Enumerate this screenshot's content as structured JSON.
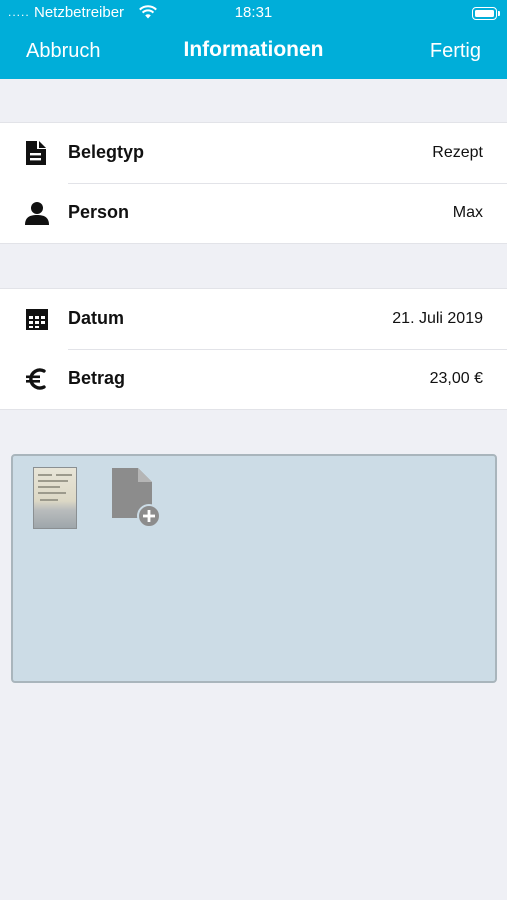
{
  "status_bar": {
    "signal": ".....",
    "carrier": "Netzbetreiber",
    "time": "18:31"
  },
  "nav": {
    "cancel_label": "Abbruch",
    "title": "Informationen",
    "done_label": "Fertig"
  },
  "group1": {
    "rows": [
      {
        "label": "Belegtyp",
        "value": "Rezept",
        "icon": "receipt-icon"
      },
      {
        "label": "Person",
        "value": "Max",
        "icon": "person-icon"
      }
    ]
  },
  "group2": {
    "rows": [
      {
        "label": "Datum",
        "value": "21. Juli 2019",
        "icon": "calendar-icon"
      },
      {
        "label": "Betrag",
        "value": "23,00  €",
        "icon": "euro-icon"
      }
    ]
  },
  "colors": {
    "accent": "#00aed9",
    "background": "#eff0f5",
    "attachment_area": "#ccdce6"
  },
  "attachments": {
    "items": [
      {
        "type": "receipt-photo-thumbnail"
      }
    ],
    "add_icon": "add-document-icon"
  }
}
